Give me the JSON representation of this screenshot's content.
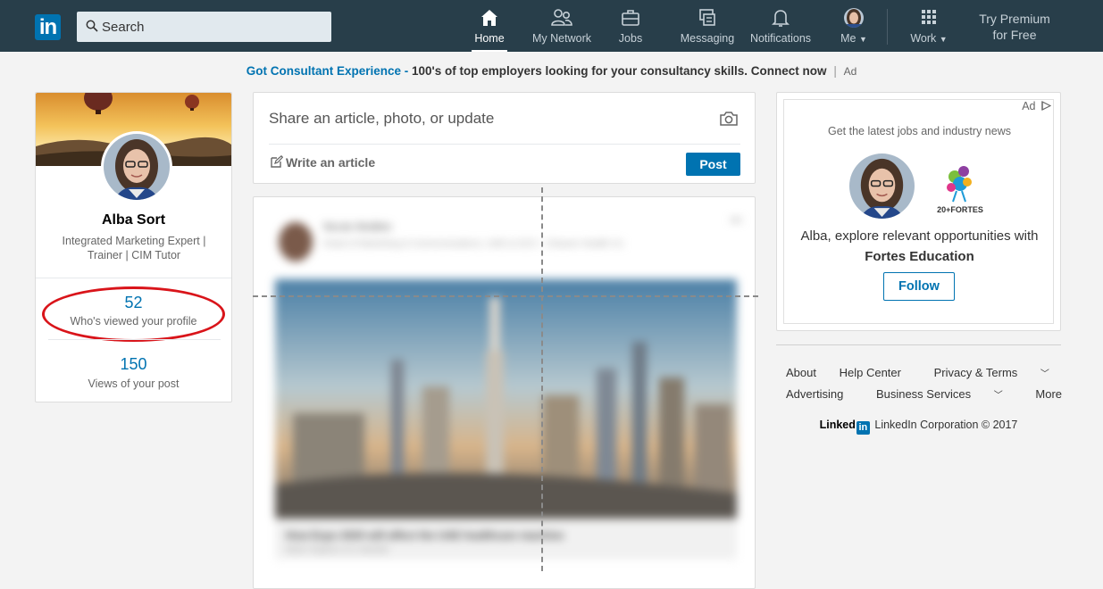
{
  "nav": {
    "logo_text": "in",
    "search_placeholder": "Search",
    "items": [
      {
        "label": "Home",
        "icon": "home-icon"
      },
      {
        "label": "My Network",
        "icon": "network-icon"
      },
      {
        "label": "Jobs",
        "icon": "briefcase-icon"
      },
      {
        "label": "Messaging",
        "icon": "messaging-icon"
      },
      {
        "label": "Notifications",
        "icon": "bell-icon"
      },
      {
        "label": "Me",
        "icon": "avatar"
      },
      {
        "label": "Work",
        "icon": "grid-icon"
      }
    ],
    "premium_line1": "Try Premium",
    "premium_line2": "for Free",
    "active_color": "#ffffff",
    "bar_color": "#283e4a"
  },
  "ad_banner": {
    "link_text": "Got Consultant Experience - ",
    "message": "100's of top employers looking for your consultancy skills. Connect now",
    "separator": "|",
    "ad_label": "Ad"
  },
  "profile": {
    "name": "Alba Sort",
    "headline": "Integrated Marketing Expert | Trainer | CIM Tutor",
    "views_count": "52",
    "views_label": "Who's viewed your profile",
    "post_views_count": "150",
    "post_views_label": "Views of your post",
    "highlight_color": "#d9141a"
  },
  "share": {
    "prompt": "Share an article, photo, or update",
    "write_article": "Write an article",
    "post_button": "Post"
  },
  "feed_post": {
    "author": "Nicole Mullikin",
    "headline": "Head of Marketing & Communications, UAE & GCC - Cleaner Health Co",
    "link_title": "How Expo 2020 will affect the UAE healthcare machine",
    "link_source": "Mark Hopkins on LinkedIn"
  },
  "right_ad": {
    "ad_label": "Ad",
    "headline": "Get the latest jobs and industry news",
    "body": "Alba, explore relevant opportunities with",
    "company": "Fortes Education",
    "follow_button": "Follow",
    "logo_text": "20+FORTES"
  },
  "footer": {
    "links_row1": [
      "About",
      "Help Center",
      "Privacy & Terms"
    ],
    "links_row2": [
      "Advertising",
      "Business Services",
      "More"
    ],
    "brand_text": "Linked",
    "brand_box": "in",
    "copyright": "LinkedIn Corporation © 2017"
  },
  "colors": {
    "brand_blue": "#0073b1",
    "page_bg": "#f3f3f3"
  }
}
